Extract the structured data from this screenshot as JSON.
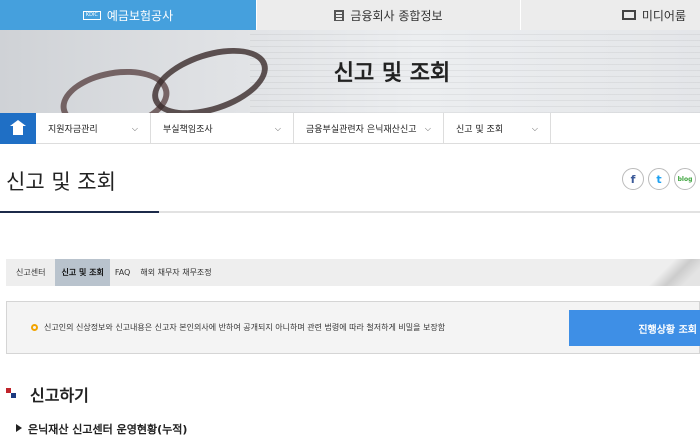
{
  "topbar": {
    "tab1": {
      "label": "예금보험공사",
      "logo_text": "KDIC"
    },
    "tab2": {
      "label": "금융회사 종합정보"
    },
    "tab3": {
      "label": "미디어룸"
    }
  },
  "banner": {
    "title": "신고 및 조회"
  },
  "nav": {
    "items": [
      {
        "label": "지원자금관리"
      },
      {
        "label": "부실책임조사"
      },
      {
        "label": "금융부실관련자 은닉재산신고"
      },
      {
        "label": "신고 및 조회"
      }
    ]
  },
  "page": {
    "title": "신고 및 조회"
  },
  "social": {
    "facebook": "f",
    "twitter": "t",
    "blog": "blog"
  },
  "subtabs": [
    {
      "label": "신고센터"
    },
    {
      "label": "신고 및 조회"
    },
    {
      "label": "FAQ"
    },
    {
      "label": "해외 채무자 채무조정"
    }
  ],
  "notice": {
    "text": "신고인의 신상정보와 신고내용은 신고자 본인의사에 반하여 공개되지 아니하며 관련 법령에 따라 철저하게 비밀을 보장함",
    "button": "진행상황 조회"
  },
  "section": {
    "title": "신고하기",
    "subtitle": "은닉재산 신고센터 운영현황(누적)"
  },
  "colors": {
    "topbar_active": "#45a0dd",
    "home": "#1f6fc5",
    "button": "#3e8fe6"
  }
}
